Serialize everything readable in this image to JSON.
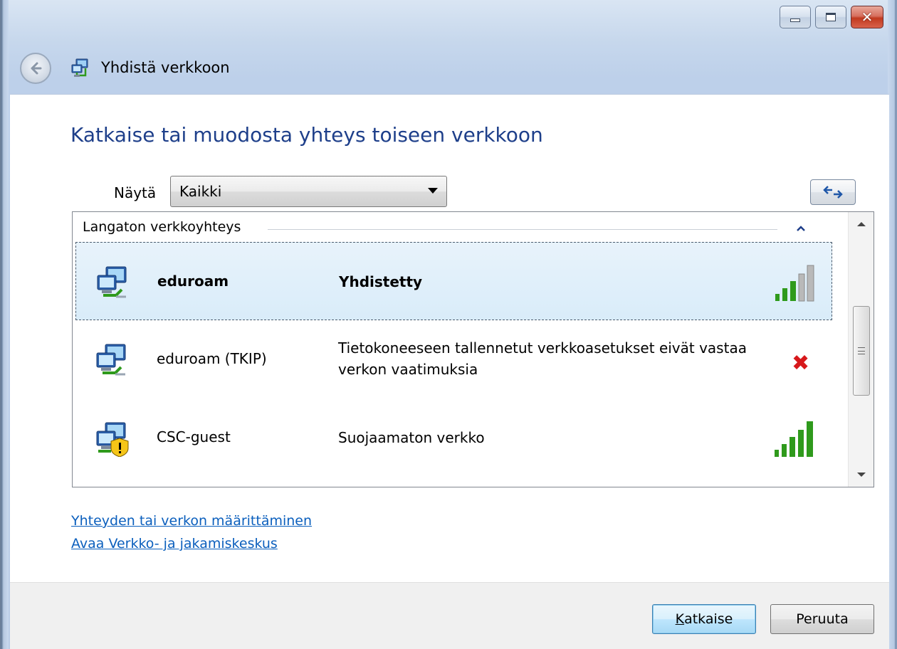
{
  "window": {
    "title": "Yhdistä verkkoon",
    "caption_buttons": [
      "minimize",
      "maximize",
      "close"
    ]
  },
  "main": {
    "headline": "Katkaise tai muodosta yhteys toiseen verkkoon",
    "show_label": "Näytä",
    "show_value": "Kaikki",
    "group_label": "Langaton verkkoyhteys",
    "networks": [
      {
        "name": "eduroam",
        "status": "Yhdistetty",
        "icon": "network-computer-icon",
        "indicator": "signal-strength",
        "signal_bars": 3,
        "selected": true
      },
      {
        "name": "eduroam (TKIP)",
        "status": "Tietokoneeseen tallennetut verkkoasetukset eivät vastaa verkon vaatimuksia",
        "icon": "network-computer-icon",
        "indicator": "error-x",
        "selected": false
      },
      {
        "name": "CSC-guest",
        "status": "Suojaamaton verkko",
        "icon": "unsecured-network-icon",
        "indicator": "signal-strength",
        "signal_bars": 5,
        "selected": false
      }
    ],
    "links": [
      "Yhteyden tai verkon määrittäminen",
      "Avaa Verkko- ja jakamiskeskus"
    ]
  },
  "footer": {
    "disconnect": {
      "accel": "K",
      "rest": "atkaise"
    },
    "cancel": "Peruuta"
  },
  "colors": {
    "headline": "#1e3f8a",
    "link": "#0b5fbd",
    "signal_green": "#2f9a1c",
    "error_red": "#d7181b"
  }
}
